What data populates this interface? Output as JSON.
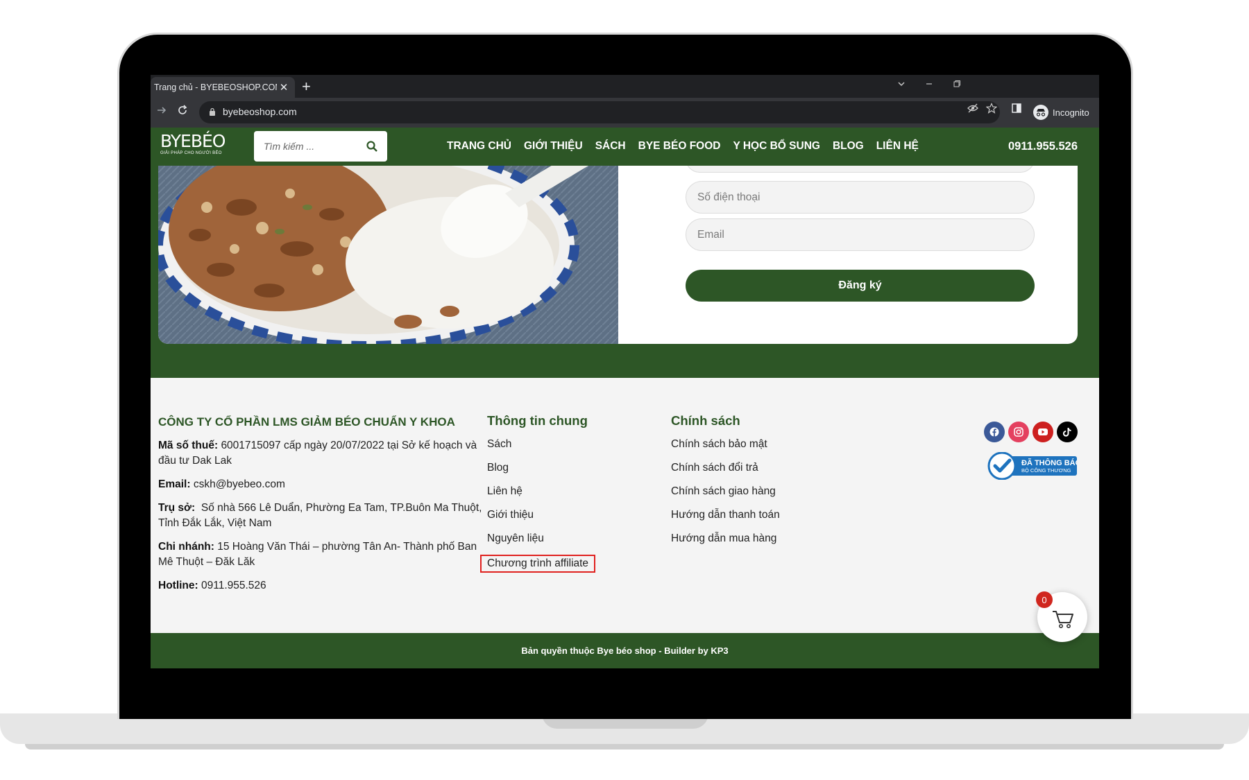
{
  "browser": {
    "tab_title": "Trang chủ - BYEBEOSHOP.COM",
    "tab_close": "✕",
    "new_tab": "+",
    "url": "byebeoshop.com",
    "profile_label": "Incognito"
  },
  "header": {
    "logo_main": "BYEBÉO",
    "logo_sub": "GIẢI PHÁP CHO NGƯỜI BÉO",
    "search_placeholder": "Tìm kiếm ...",
    "menu": [
      "TRANG CHỦ",
      "GIỚI THIỆU",
      "SÁCH",
      "BYE BÉO FOOD",
      "Y HỌC BỔ SUNG",
      "BLOG",
      "LIÊN HỆ"
    ],
    "phone": "0911.955.526"
  },
  "newsletter": {
    "phone_placeholder": "Số điện thoại",
    "email_placeholder": "Email",
    "submit_label": "Đăng ký"
  },
  "footer": {
    "company_name": "CÔNG TY CỔ PHẦN LMS GIẢM BÉO CHUẨN Y KHOA",
    "tax_label": "Mã số thuế:",
    "tax_value": "6001715097 cấp ngày 20/07/2022 tại Sở kế hoạch và đầu tư Dak Lak",
    "email_label": "Email:",
    "email_value": "cskh@byebeo.com",
    "hq_label": "Trụ sở:",
    "hq_value": "Số nhà 566 Lê Duẩn, Phường Ea Tam, TP.Buôn Ma Thuột, Tỉnh Đắk Lắk, Việt Nam",
    "branch_label": "Chi nhánh:",
    "branch_value": "15 Hoàng Văn Thái – phường Tân An- Thành phố Ban Mê Thuột – Đăk Lăk",
    "hotline_label": "Hotline:",
    "hotline_value": "0911.955.526",
    "col1_title": "Thông tin chung",
    "col1_links": [
      "Sách",
      "Blog",
      "Liên hệ",
      "Giới thiệu",
      "Nguyên liệu",
      "Chương trình affiliate"
    ],
    "col2_title": "Chính sách",
    "col2_links": [
      "Chính sách bảo mật",
      "Chính sách đổi trả",
      "Chính sách giao hàng",
      "Hướng dẫn thanh toán",
      "Hướng dẫn mua hàng"
    ],
    "badge_line1": "ĐÃ THÔNG BÁO",
    "badge_line2": "BỘ CÔNG THƯƠNG",
    "cart_count": "0",
    "copyright": "Bản quyền thuộc Bye béo shop - Builder by KP3"
  },
  "colors": {
    "brand_green": "#2d5626",
    "highlight_red": "#e0201e",
    "facebook": "#3b5998",
    "instagram": "#e4405f",
    "youtube": "#cd201f",
    "tiktok": "#000000"
  },
  "icons": [
    "back-arrow-icon",
    "reload-icon",
    "lock-icon",
    "eye-off-icon",
    "star-icon",
    "sidebar-icon",
    "incognito-icon",
    "search-icon",
    "facebook-icon",
    "instagram-icon",
    "youtube-icon",
    "tiktok-icon",
    "cart-icon"
  ]
}
